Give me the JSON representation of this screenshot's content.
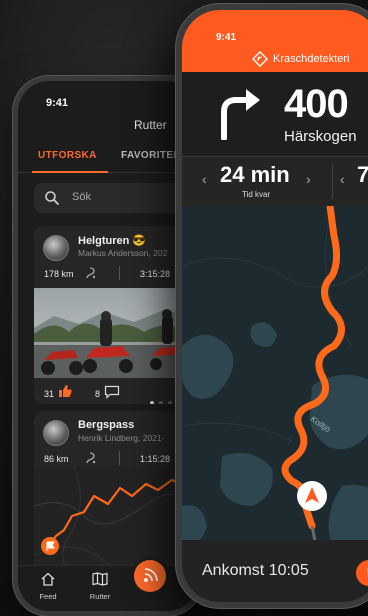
{
  "back_phone": {
    "status_time": "9:41",
    "title": "Rutter",
    "tabs": [
      {
        "label": "UTFORSKA",
        "active": true
      },
      {
        "label": "FAVORITER",
        "active": false
      }
    ],
    "search": {
      "placeholder": "Sök"
    },
    "cards": [
      {
        "title": "Helgturen 😎",
        "subtitle": "Markus Andersson, 202",
        "distance": "178 km",
        "duration": "3:15:28",
        "likes": "31",
        "comments": "8"
      },
      {
        "title": "Bergspass",
        "subtitle": "Henrik Lindberg, 2021-",
        "distance": "86 km",
        "duration": "1:15:28"
      }
    ],
    "nav": [
      {
        "label": "Feed",
        "icon": "home-icon"
      },
      {
        "label": "Rutter",
        "icon": "map-icon"
      }
    ]
  },
  "front_phone": {
    "status_time": "9:41",
    "crash_banner": "Kraschdetekteri",
    "next_turn_distance": "400",
    "next_street": "Härskogen",
    "time_left_value": "24 min",
    "time_left_label": "Tid kvar",
    "second_stat_value": "7",
    "map_label": "Kolltjö",
    "arrival": "Ankomst 10:05",
    "action_button": "P"
  },
  "colors": {
    "accent": "#ff5a1f",
    "route": "#ff6a1a",
    "map_land": "#1d2a30",
    "map_water": "#2d4650"
  }
}
